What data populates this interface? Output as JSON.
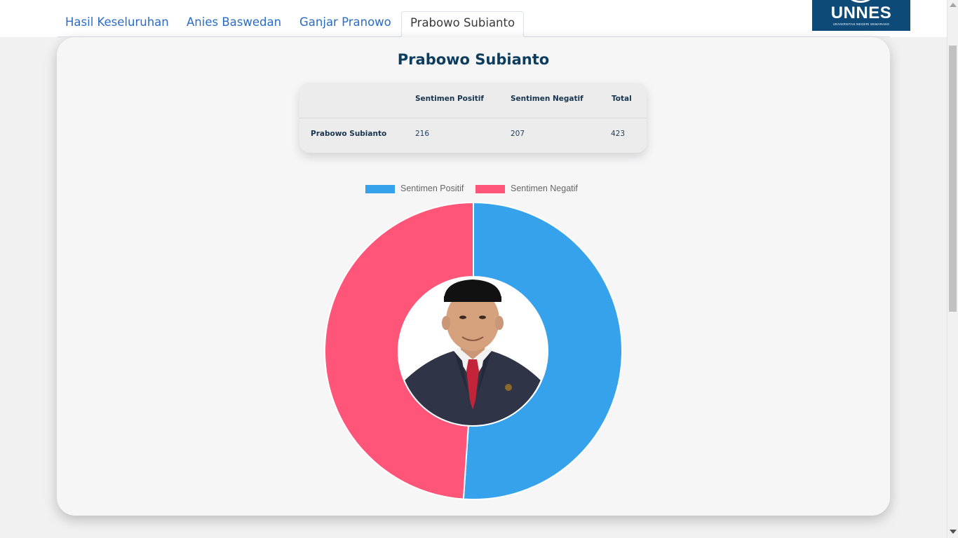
{
  "tabs": [
    {
      "label": "Hasil Keseluruhan"
    },
    {
      "label": "Anies Baswedan"
    },
    {
      "label": "Ganjar Pranowo"
    },
    {
      "label": "Prabowo Subianto"
    }
  ],
  "active_tab": "Prabowo Subianto",
  "logo": {
    "name": "UNNES",
    "subtitle": "UNIVERSITAS NEGERI SEMARANG"
  },
  "card": {
    "title": "Prabowo Subianto"
  },
  "table": {
    "headers": [
      "",
      "Sentimen Positif",
      "Sentimen Negatif",
      "Total"
    ],
    "rows": [
      {
        "name": "Prabowo Subianto",
        "positif": "216",
        "negatif": "207",
        "total": "423"
      }
    ]
  },
  "colors": {
    "positif": "#36a2eb",
    "negatif": "#ff5578",
    "title": "#0c3d5e",
    "tab_link": "#2b6cc4"
  },
  "chart_data": {
    "type": "pie",
    "variant": "doughnut",
    "labels": [
      "Sentimen Positif",
      "Sentimen Negatif"
    ],
    "values": [
      216,
      207
    ],
    "legend_position": "top",
    "center_image": "candidate-portrait"
  }
}
